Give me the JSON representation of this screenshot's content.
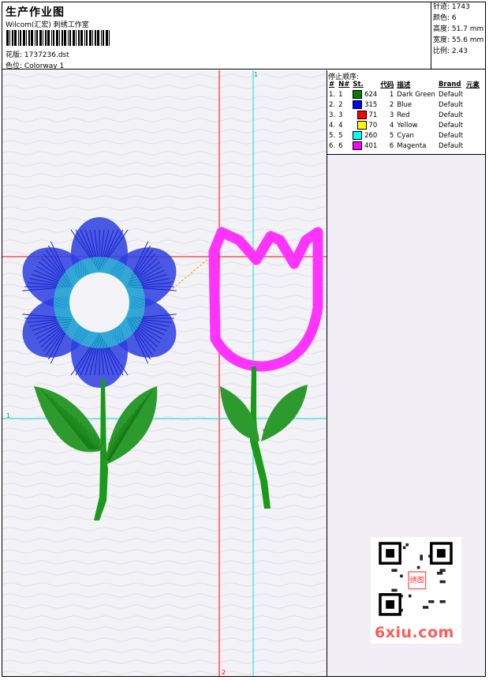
{
  "header": {
    "title": "生产作业图",
    "company": "Wilcom(汇宏) 刺绣工作室",
    "design_label": "花版: 1737236.dst",
    "colorway_label": "色位: Colorway 1"
  },
  "stats": {
    "stitches": "针迹: 1743",
    "colors": "颜色: 6",
    "height": "高度: 51.7 mm",
    "width": "宽度: 55.6 mm",
    "scale": "比例: 2.43"
  },
  "stop_sequence": {
    "label": "停止顺序:",
    "headers": [
      "#",
      "N#",
      "St.",
      "代码",
      "描述",
      "Brand",
      "元素"
    ],
    "rows": [
      {
        "idx": "1.",
        "n": "1",
        "color": "#008000",
        "st": "624",
        "code": "1",
        "desc": "Dark Green",
        "brand": "Default"
      },
      {
        "idx": "2.",
        "n": "2",
        "color": "#0000ff",
        "st": "315",
        "code": "2",
        "desc": "Blue",
        "brand": "Default"
      },
      {
        "idx": "3.",
        "n": "3",
        "color": "#ff0000",
        "st": "71",
        "code": "3",
        "desc": "Red",
        "brand": "Default"
      },
      {
        "idx": "4.",
        "n": "4",
        "color": "#ffff00",
        "st": "70",
        "code": "4",
        "desc": "Yellow",
        "brand": "Default"
      },
      {
        "idx": "5.",
        "n": "5",
        "color": "#00ffff",
        "st": "260",
        "code": "5",
        "desc": "Cyan",
        "brand": "Default"
      },
      {
        "idx": "6.",
        "n": "6",
        "color": "#ff00ff",
        "st": "401",
        "code": "6",
        "desc": "Magenta",
        "brand": "Default"
      }
    ]
  },
  "guides": {
    "top_cyan": "1",
    "left_cyan": "1",
    "right_red": "2",
    "bottom_red": "2"
  },
  "watermark": {
    "brand_text": "6xiu.com",
    "seal_text": "绣图"
  },
  "colors": {
    "red_guide": "#ff0000",
    "cyan_guide": "#00e0e0",
    "canvas_bg": "#f3f2f7"
  }
}
